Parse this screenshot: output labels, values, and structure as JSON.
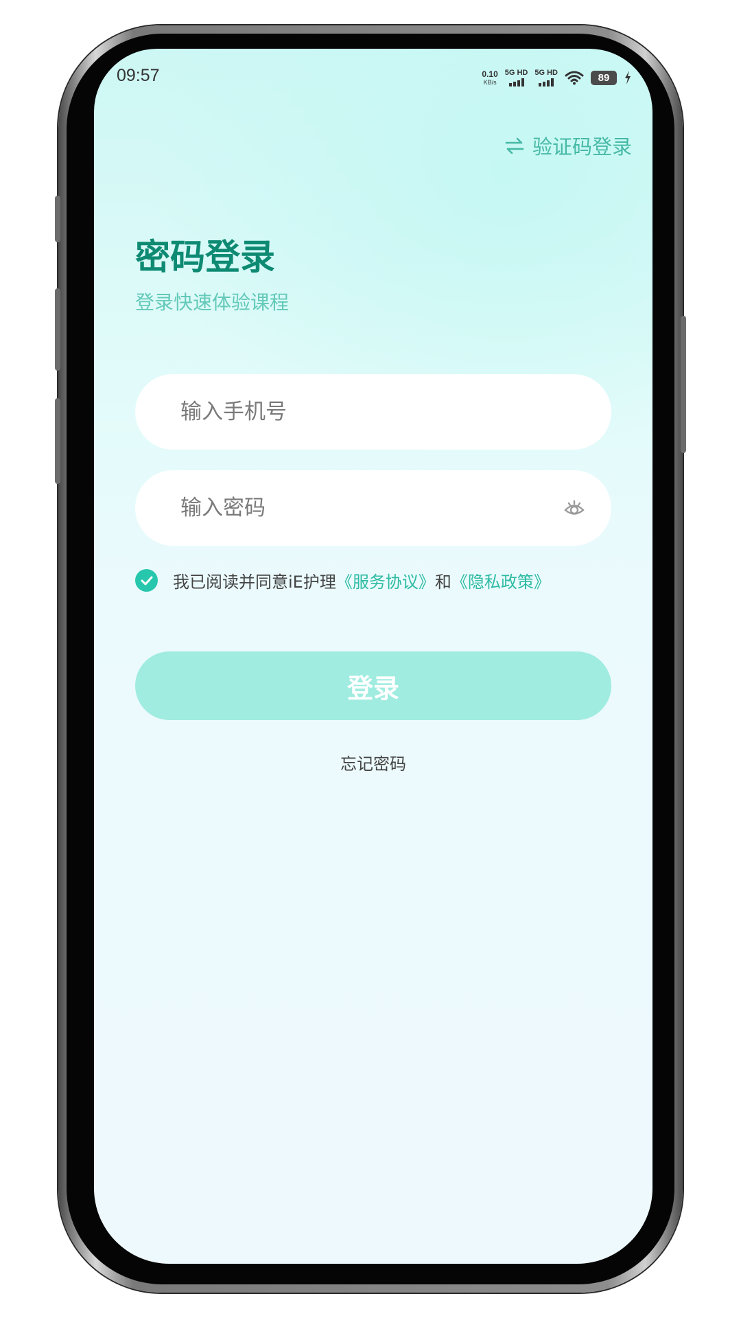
{
  "status_bar": {
    "time": "09:57",
    "net_speed_value": "0.10",
    "net_speed_unit": "KB/s",
    "sim1_label": "5G HD",
    "sim2_label": "5G HD",
    "battery": "89"
  },
  "header": {
    "switch_login_label": "验证码登录",
    "title": "密码登录",
    "subtitle": "登录快速体验课程"
  },
  "form": {
    "phone_placeholder": "输入手机号",
    "phone_value": "",
    "password_placeholder": "输入密码",
    "password_value": ""
  },
  "agreement": {
    "checked": true,
    "prefix": "我已阅读并同意iE护理",
    "service_link": "《服务协议》",
    "and": "和",
    "privacy_link": "《隐私政策》"
  },
  "actions": {
    "login_label": "登录",
    "forgot_password_label": "忘记密码"
  },
  "colors": {
    "accent": "#27c7ad",
    "title": "#0e8a73",
    "login_button": "#a0ece0",
    "background_top": "#cdf7f4",
    "background_bottom": "#eef9fd"
  },
  "icons": [
    "swap-arrows-icon",
    "eye-icon",
    "checkmark-icon",
    "wifi-icon",
    "charging-bolt-icon"
  ]
}
